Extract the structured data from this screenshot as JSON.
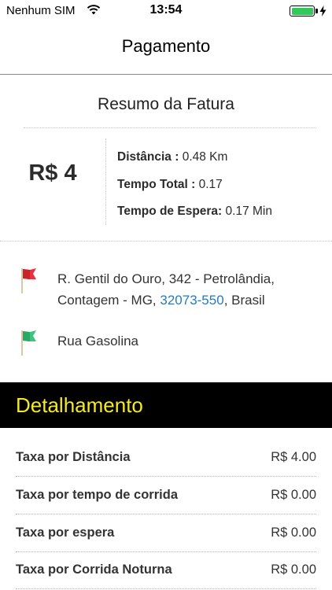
{
  "status_bar": {
    "carrier": "Nenhum SIM",
    "time": "13:54",
    "battery_level": 1.0,
    "charging": true,
    "icons": [
      "wifi-icon",
      "battery-icon",
      "charging-icon"
    ]
  },
  "nav": {
    "title": "Pagamento"
  },
  "summary": {
    "title": "Resumo da Fatura",
    "total": "R$ 4",
    "details": [
      {
        "label": "Distância :",
        "value": " 0.48 Km"
      },
      {
        "label": "Tempo Total :",
        "value": " 0.17"
      },
      {
        "label": "Tempo de Espera:",
        "value": " 0.17 Min"
      }
    ]
  },
  "route": {
    "origin": {
      "line1": "R. Gentil do Ouro, 342 - Petrolândia,",
      "line2_prefix": "Contagem - MG, ",
      "postal_code": "32073-550",
      "line2_suffix": ", Brasil",
      "icon": "red-flag-icon",
      "color": "#e8323b"
    },
    "destination": {
      "text": "Rua Gasolina",
      "icon": "green-flag-icon",
      "color": "#3cc57f"
    }
  },
  "breakdown": {
    "title": "Detalhamento",
    "header_bg": "#000000",
    "header_fg": "#f5ea1e",
    "rows": [
      {
        "label": "Taxa por Distância",
        "value": "R$ 4.00"
      },
      {
        "label": "Taxa por tempo de corrida",
        "value": "R$ 0.00"
      },
      {
        "label": "Taxa por espera",
        "value": "R$ 0.00"
      },
      {
        "label": "Taxa por Corrida Noturna",
        "value": "R$ 0.00"
      }
    ]
  },
  "colors": {
    "link": "#2a7ab8",
    "battery": "#34c759"
  }
}
